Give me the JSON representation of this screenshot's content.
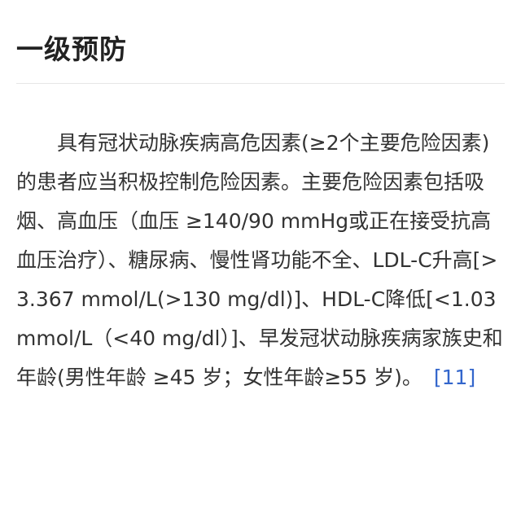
{
  "article": {
    "heading": "一级预防",
    "paragraph": "具有冠状动脉疾病高危因素(≥2个主要危险因素)的患者应当积极控制危险因素。主要危险因素包括吸烟、高血压（血压 ≥140/90 mmHg或正在接受抗高血压治疗）、糖尿病、慢性肾功能不全、LDL-C升高[>3.367 mmol/L(>130 mg/dl)]、HDL-C降低[<1.03 mmol/L（<40 mg/dl）]、早发冠状动脉疾病家族史和年龄(男性年龄 ≥45 岁；女性年龄≥55 岁)。",
    "reference": "[11]"
  },
  "colors": {
    "text": "#333333",
    "heading": "#222222",
    "link": "#3366cc",
    "divider": "#e6e6e6"
  }
}
